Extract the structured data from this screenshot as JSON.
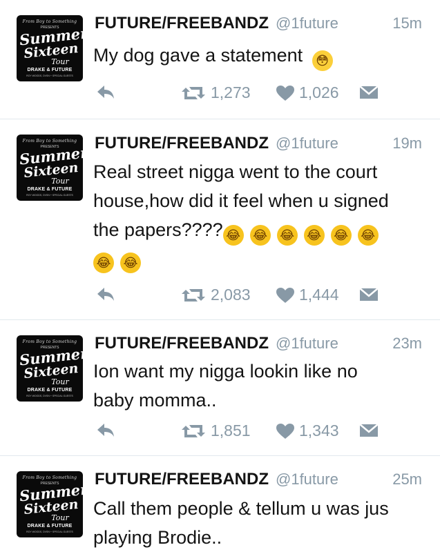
{
  "avatar_art": {
    "top": "From Boy to Something",
    "presents": "PRESENTS",
    "summer": "Summer",
    "sixteen": "Sixteen",
    "tour": "Tour",
    "artists": "DRAKE & FUTURE",
    "guests": "ROY WOODS, DVSN + SPECIAL GUESTS"
  },
  "tweets": [
    {
      "name": "FUTURE/FREEBANDZ",
      "handle": "@1future",
      "time": "15m",
      "text_lines": [
        "My dog gave a statement"
      ],
      "emoji_line": "",
      "emoji_line2": "",
      "retweets": "1,273",
      "likes": "1,026"
    },
    {
      "name": "FUTURE/FREEBANDZ",
      "handle": "@1future",
      "time": "19m",
      "text_lines": [
        "Real street nigga went to the court",
        "house,how did it feel when u signed",
        "the papers????"
      ],
      "emoji_line": "",
      "emoji_line2": "",
      "retweets": "2,083",
      "likes": "1,444"
    },
    {
      "name": "FUTURE/FREEBANDZ",
      "handle": "@1future",
      "time": "23m",
      "text_lines": [
        "Ion want my nigga lookin like no",
        "baby momma.."
      ],
      "emoji_line": "",
      "emoji_line2": "",
      "retweets": "1,851",
      "likes": "1,343"
    },
    {
      "name": "FUTURE/FREEBANDZ",
      "handle": "@1future",
      "time": "25m",
      "text_lines": [
        "Call them people & tellum u was jus",
        "playing Brodie.."
      ],
      "emoji_line": "",
      "emoji_line2": "",
      "retweets": "",
      "likes": ""
    }
  ],
  "icons": {
    "reply": "reply-arrow-icon",
    "retweet": "retweet-icon",
    "like": "heart-icon",
    "message": "envelope-icon",
    "flushed": "flushed-face-emoji",
    "crying": "face-with-tears-of-joy-emoji"
  },
  "colors": {
    "text": "#141414",
    "muted": "#8899a6",
    "divider": "#e1e8ed",
    "emoji": "#f7c31e"
  }
}
